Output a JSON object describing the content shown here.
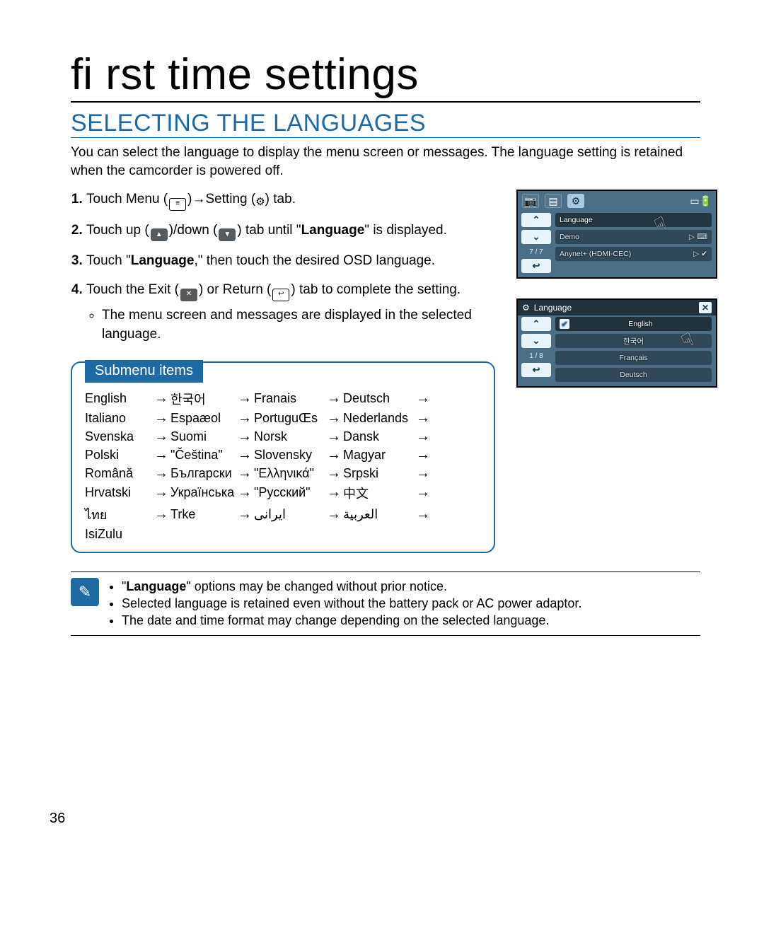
{
  "title": "ﬁ rst time settings",
  "section_heading": "SELECTING THE LANGUAGES",
  "intro": "You can select the language to display the menu screen or messages. The language setting is retained when the camcorder is powered off.",
  "steps": {
    "s1_pre": "Touch Menu (",
    "s1_mid": ")→Setting (",
    "s1_end": ") tab.",
    "s2_pre": "Touch up (",
    "s2_mid": ")/down (",
    "s2_end": ") tab until \"",
    "s2_lang": "Language",
    "s2_tail": "\" is displayed.",
    "s3_pre": "Touch \"",
    "s3_lang": "Language",
    "s3_end": ",\" then touch the desired OSD language.",
    "s4_pre": "Touch the Exit (",
    "s4_mid": ") or Return (",
    "s4_end": ") tab to complete the setting.",
    "s4_bullet": "The menu screen and messages are displayed in the selected language."
  },
  "submenu_label": "Submenu items",
  "languages": [
    "English",
    "한국어",
    "Franais",
    "Deutsch",
    "Italiano",
    "Espaæol",
    "PortuguŒs",
    "Nederlands",
    "Svenska",
    "Suomi",
    "Norsk",
    "Dansk",
    "Polski",
    "\"Čeština\"",
    "Slovensky",
    "Magyar",
    "Română",
    "Български",
    "\"Ελληνικά\"",
    "Srpski",
    "Hrvatski",
    "Українська",
    "\"Русский\"",
    "中文",
    "ไทย",
    "Trke",
    "ايرانى",
    "العربية",
    "IsiZulu"
  ],
  "notes": [
    "\"Language\" options may be changed without prior notice.",
    "Selected language is retained even without the battery pack or AC power adaptor.",
    "The date and time format may change depending on the selected language."
  ],
  "page_number": "36",
  "osd1": {
    "row1": "Language",
    "row2": "Demo",
    "row3": "Anynet+ (HDMI-CEC)",
    "page": "7 / 7"
  },
  "osd2": {
    "title": "Language",
    "items": [
      "English",
      "한국어",
      "Français",
      "Deutsch"
    ],
    "page": "1 / 8"
  }
}
